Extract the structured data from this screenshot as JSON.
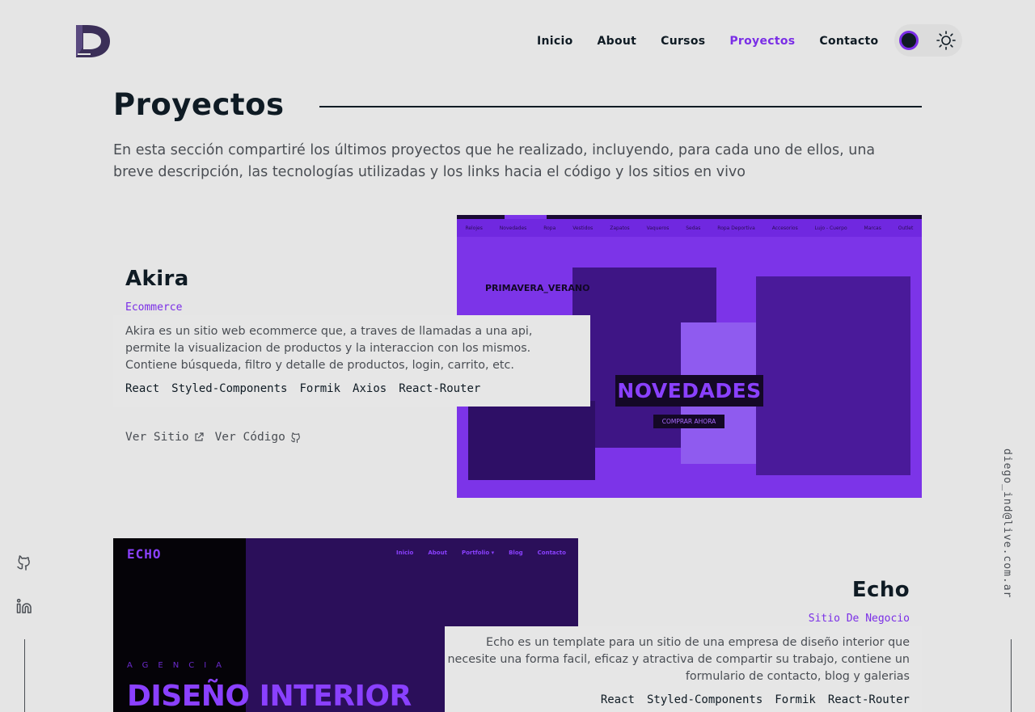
{
  "nav": {
    "items": [
      {
        "label": "Inicio",
        "active": false
      },
      {
        "label": "About",
        "active": false
      },
      {
        "label": "Cursos",
        "active": false
      },
      {
        "label": "Proyectos",
        "active": true
      },
      {
        "label": "Contacto",
        "active": false
      }
    ]
  },
  "section": {
    "title": "Proyectos",
    "intro": "En esta sección compartiré los últimos proyectos que he realizado, incluyendo, para cada uno de ellos, una breve descripción, las tecnologías utilizadas y los links hacia el código y los sitios en vivo"
  },
  "projects": [
    {
      "title": "Akira",
      "type": "Ecommerce",
      "description": "Akira es un sitio web ecommerce que, a traves de llamadas a una api, permite la visualizacion de productos y la interaccion con los mismos. Contiene búsqueda, filtro y detalle de productos, login, carrito, etc.",
      "tech": [
        "React",
        "Styled-Components",
        "Formik",
        "Axios",
        "React-Router"
      ],
      "links": {
        "site": "Ver Sitio",
        "code": "Ver Código"
      },
      "preview": {
        "nav": [
          "Relojes",
          "Novedades",
          "Ropa",
          "Vestidos",
          "Zapatos",
          "Vaqueros",
          "Sedas",
          "Ropa Deportiva",
          "Accesorios",
          "Lujo - Cuerpo",
          "Marcas",
          "Outlet"
        ],
        "label": "PRIMAVERA_VERANO",
        "banner": "NOVEDADES",
        "button": "COMPRAR AHORA"
      }
    },
    {
      "title": "Echo",
      "type": "Sitio De Negocio",
      "description": "Echo es un template para un sitio de una empresa de diseño interior que necesite una forma facil, eficaz y atractiva de compartir su trabajo, contiene un formulario de contacto, blog y galerias",
      "tech": [
        "React",
        "Styled-Components",
        "Formik",
        "React-Router"
      ],
      "preview": {
        "logo": "ECHO",
        "nav": [
          "Inicio",
          "About",
          "Portfolio ▾",
          "Blog",
          "Contacto"
        ],
        "sub": "AGENCIA",
        "big": "DISEÑO INTERIOR"
      }
    }
  ],
  "contact": {
    "email": "diego_ind@live.com.ar"
  },
  "colors": {
    "accent": "#7a2ee6",
    "bg": "#e5e5e5",
    "text": "#0f1b24"
  }
}
